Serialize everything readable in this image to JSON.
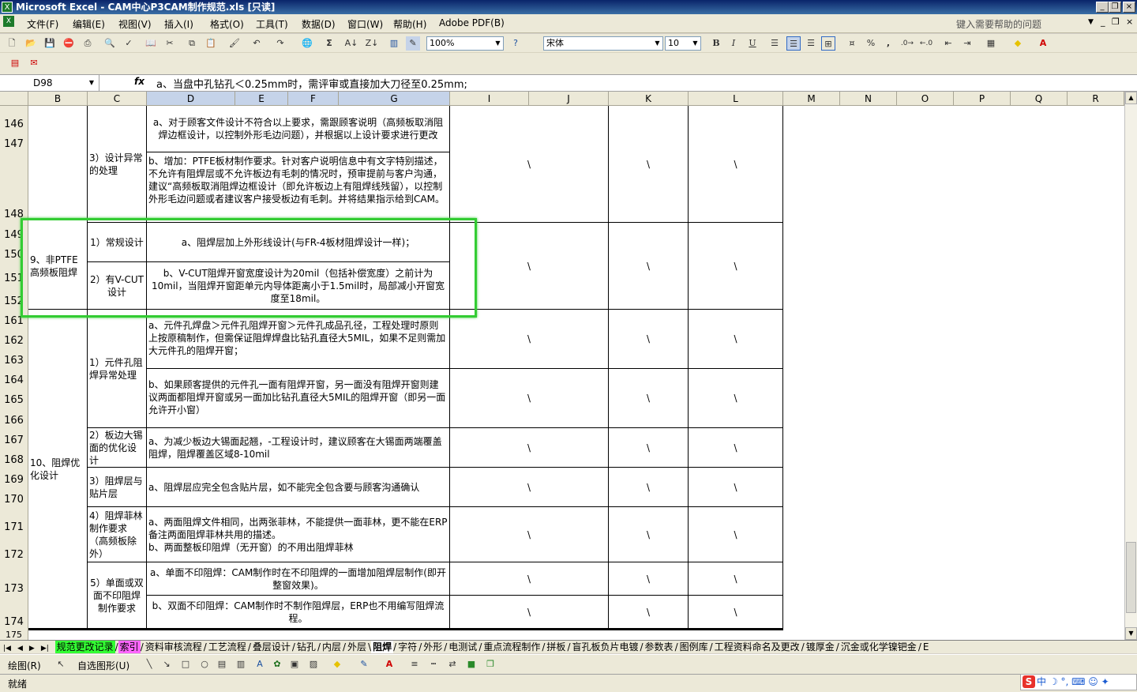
{
  "window": {
    "title": "Microsoft Excel - CAM中心P3CAM制作规范.xls [只读]"
  },
  "menu": {
    "items": [
      "文件(F)",
      "编辑(E)",
      "视图(V)",
      "插入(I)",
      "格式(O)",
      "工具(T)",
      "数据(D)",
      "窗口(W)",
      "帮助(H)",
      "Adobe PDF(B)"
    ],
    "help_placeholder": "键入需要帮助的问题"
  },
  "toolbar": {
    "zoom": "100%",
    "font": "宋体",
    "font_size": "10"
  },
  "formula_bar": {
    "name_box": "D98",
    "fx": "fx",
    "content": "a、当盘中孔钻孔＜0.25mm时，需评审或直接加大刀径至0.25mm;"
  },
  "columns": [
    "B",
    "C",
    "D",
    "E",
    "F",
    "G",
    "I",
    "J",
    "K",
    "L",
    "M",
    "N",
    "O",
    "P",
    "Q",
    "R"
  ],
  "rows": [
    "146",
    "147",
    "148",
    "149",
    "150",
    "151",
    "152",
    "161",
    "162",
    "163",
    "164",
    "165",
    "166",
    "167",
    "168",
    "169",
    "170",
    "171",
    "172",
    "173",
    "174",
    "175"
  ],
  "cells": {
    "c_design_abnormal": "3）设计异常的处理",
    "d_146": "a、对于顾客文件设计不符合以上要求，需跟顾客说明（高频板取消阻焊边框设计，以控制外形毛边问题），并根据以上设计要求进行更改",
    "d_148": "b、增加：PTFE板材制作要求。针对客户说明信息中有文字特别描述，不允许有阻焊层或不允许板边有毛刺的情况时，预审提前与客户沟通，建议“高频板取消阻焊边框设计（即允许板边上有阻焊线残留），以控制外形毛边问题或者建议客户接受板边有毛刺。并将结果指示给到CAM。",
    "b_non_ptfe": "9、非PTFE高频板阻焊",
    "c_regular": "1）常规设计",
    "d_regular": "a、阻焊层加上外形线设计(与FR-4板材阻焊设计一样)；",
    "c_vcut": "2）有V-CUT设计",
    "d_vcut": "b、V-CUT阻焊开窗宽度设计为20mil（包括补偿宽度）之前计为10mil，当阻焊开窗距单元内导体距离小于1.5mil时，局部减小开窗宽度至18mil。",
    "b_optimize": "10、阻焊优化设计",
    "c_component": "1）元件孔阻焊异常处理",
    "d_component_a": "a、元件孔焊盘＞元件孔阻焊开窗＞元件孔成品孔径，工程处理时原则上按原稿制作，但需保证阻焊焊盘比钻孔直径大5MIL，如果不足则需加大元件孔的阻焊开窗；",
    "d_component_b": "b、如果顾客提供的元件孔一面有阻焊开窗，另一面没有阻焊开窗则建议两面都阻焊开窗或另一面加比钻孔直径大5MIL的阻焊开窗（即另一面允许开小窗）",
    "c_copper": "2）板边大锡面的优化设计",
    "d_copper": "a、为减少板边大锡面起翘，-工程设计时，建议顾客在大锡面两端覆盖阻焊，阻焊覆盖区域8-10mil",
    "c_pad": "3）阻焊层与贴片层",
    "d_pad": "a、阻焊层应完全包含贴片层，如不能完全包含要与顾客沟通确认",
    "c_film": "4）阻焊菲林制作要求（高频板除外）",
    "d_film": "a、两面阻焊文件相同，出两张菲林，不能提供一面菲林，更不能在ERP备注两面阻焊菲林共用的描述。\nb、两面整板印阻焊（无开窗）的不用出阻焊菲林",
    "c_single": "5）单面或双面不印阻焊制作要求",
    "d_single_a": "a、单面不印阻焊：CAM制作时在不印阻焊的一面增加阻焊层制作(即开整窗效果)。",
    "d_single_b": "b、双面不印阻焊：CAM制作时不制作阻焊层，ERP也不用编写阻焊流程。",
    "backslash": "\\"
  },
  "sheet_tabs": [
    "规范更改记录",
    "索引",
    "资料审核流程",
    "工艺流程",
    "叠层设计",
    "钻孔",
    "内层",
    "外层",
    "阻焊",
    "字符",
    "外形",
    "电测试",
    "重点流程制作",
    "拼板",
    "盲孔板负片电镀",
    "参数表",
    "图例库",
    "工程资料命名及更改",
    "镀厚金",
    "沉金或化学镍钯金",
    "E"
  ],
  "draw_toolbar": {
    "draw": "绘图(R)",
    "autoshape": "自选图形(U)"
  },
  "status": {
    "text": "就绪"
  },
  "ime": {
    "label": "中"
  },
  "colors": {
    "highlight": "#33cc33",
    "active_tab": "#ff66ff",
    "first_tab": "#33ff33"
  }
}
